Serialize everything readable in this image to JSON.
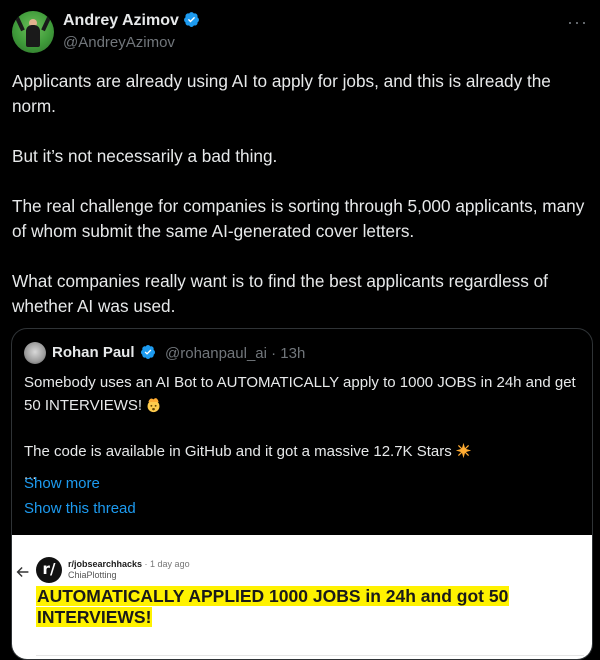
{
  "post": {
    "author_name": "Andrey Azimov",
    "author_handle": "@AndreyAzimov",
    "more_label": "···",
    "paragraphs": [
      "Applicants are already using AI to apply for jobs, and this is already the norm.",
      "But it’s not necessarily a bad thing.",
      "The real challenge for companies is sorting through 5,000 applicants, many of whom submit the same AI-generated cover letters.",
      "What companies really want is to find the best applicants regardless of whether AI was used."
    ]
  },
  "quote": {
    "author_name": "Rohan Paul",
    "author_handle_time": "@rohanpaul_ai · 13h",
    "line1": "Somebody uses an AI Bot to AUTOMATICALLY apply to 1000 JOBS in 24h and get 50 INTERVIEWS!",
    "line2": "The code is available in GitHub and it got a massive 12.7K Stars",
    "ellipsis": "...",
    "show_more": "Show more",
    "show_thread": "Show this thread",
    "emoji_1": "exploding-head-emoji",
    "emoji_2": "sparkle-emoji"
  },
  "media": {
    "subreddit": "r/jobsearchhacks",
    "time": " · 1 day ago",
    "username": "ChiaPlotting",
    "logo_text": "r/",
    "title": "AUTOMATICALLY APPLIED 1000 JOBS in 24h and got 50 INTERVIEWS!",
    "highlight_color": "#fff200"
  },
  "colors": {
    "background": "#000000",
    "text": "#e7e9ea",
    "muted": "#71767b",
    "link": "#1d9bf0",
    "verified": "#1d9bf0"
  }
}
